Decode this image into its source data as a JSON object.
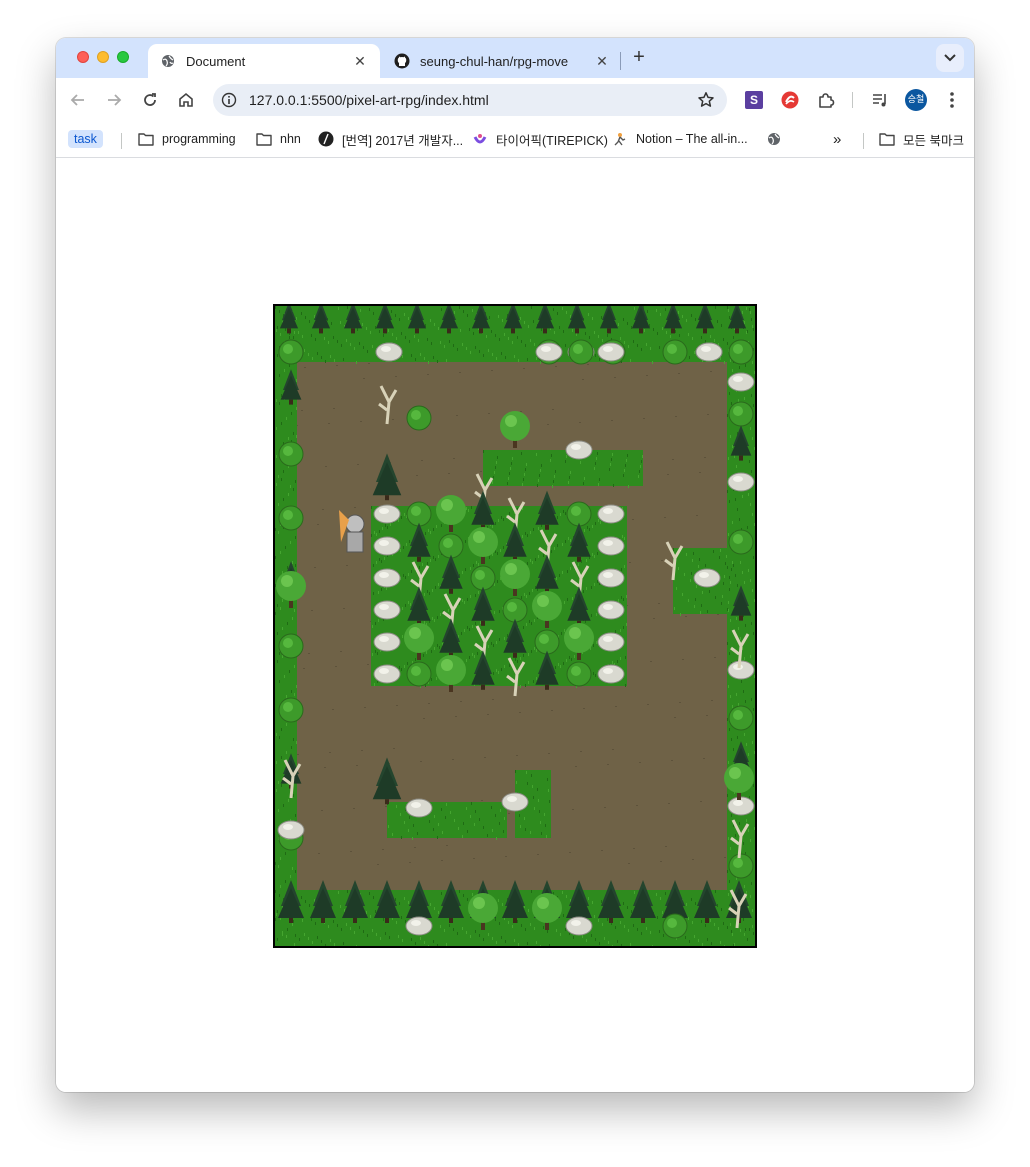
{
  "browser": {
    "tabs": [
      {
        "title": "Document",
        "favicon": "globe-icon",
        "active": true
      },
      {
        "title": "seung-chul-han/rpg-move",
        "favicon": "github-icon",
        "active": false
      }
    ],
    "url": "127.0.0.1:5500/pixel-art-rpg/index.html",
    "avatar_text": "승철",
    "extension_s_label": "S",
    "bookmarks": [
      {
        "label": "task",
        "icon": "none"
      },
      {
        "label": "programming",
        "icon": "folder-icon"
      },
      {
        "label": "nhn",
        "icon": "folder-icon"
      },
      {
        "label": "[번역] 2017년 개발자...",
        "icon": "site-icon"
      },
      {
        "label": "타이어픽(TIREPICK)",
        "icon": "site-icon"
      },
      {
        "label": "Notion – The all-in...",
        "icon": "notion-icon"
      },
      {
        "label": "",
        "icon": "globe-icon"
      }
    ],
    "all_bookmarks": "모든 북마크",
    "overflow": "»"
  },
  "game": {
    "colors": {
      "dirt": "#6f6247",
      "grass": "#2e8b1e",
      "grass_dark": "#1f6b14",
      "pine": "#24452e",
      "rock": "#d9d9d0",
      "bush": "#3d9a2a",
      "dead_tree": "#d8d2b8"
    },
    "player": "character-sprite"
  }
}
